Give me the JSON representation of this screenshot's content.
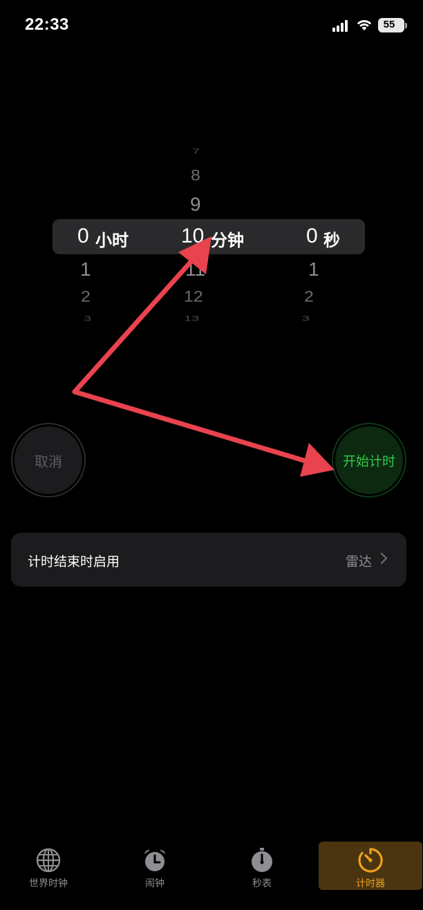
{
  "status_bar": {
    "time": "22:33",
    "battery": "55",
    "icons": [
      "signal-icon",
      "wifi-icon",
      "battery-icon"
    ]
  },
  "picker": {
    "hours": {
      "above": [],
      "selected": "0",
      "unit": "小时",
      "below": [
        "1",
        "2",
        "3"
      ]
    },
    "minutes": {
      "above": [
        "7",
        "8",
        "9"
      ],
      "selected": "10",
      "unit": "分钟",
      "below": [
        "11",
        "12",
        "13"
      ]
    },
    "seconds": {
      "above": [],
      "selected": "0",
      "unit": "秒",
      "below": [
        "1",
        "2",
        "3"
      ]
    }
  },
  "buttons": {
    "cancel": "取消",
    "start": "开始计时"
  },
  "setting": {
    "label": "计时结束时启用",
    "value": "雷达"
  },
  "tabs": [
    {
      "label": "世界时钟",
      "icon": "globe-icon",
      "active": false
    },
    {
      "label": "闹钟",
      "icon": "alarm-clock-icon",
      "active": false
    },
    {
      "label": "秒表",
      "icon": "stopwatch-icon",
      "active": false
    },
    {
      "label": "计时器",
      "icon": "timer-icon",
      "active": true
    }
  ],
  "colors": {
    "accent_active_tab": "#f0a01e",
    "start_button_text": "#33c94a",
    "annotation_arrow": "#e8434e"
  }
}
